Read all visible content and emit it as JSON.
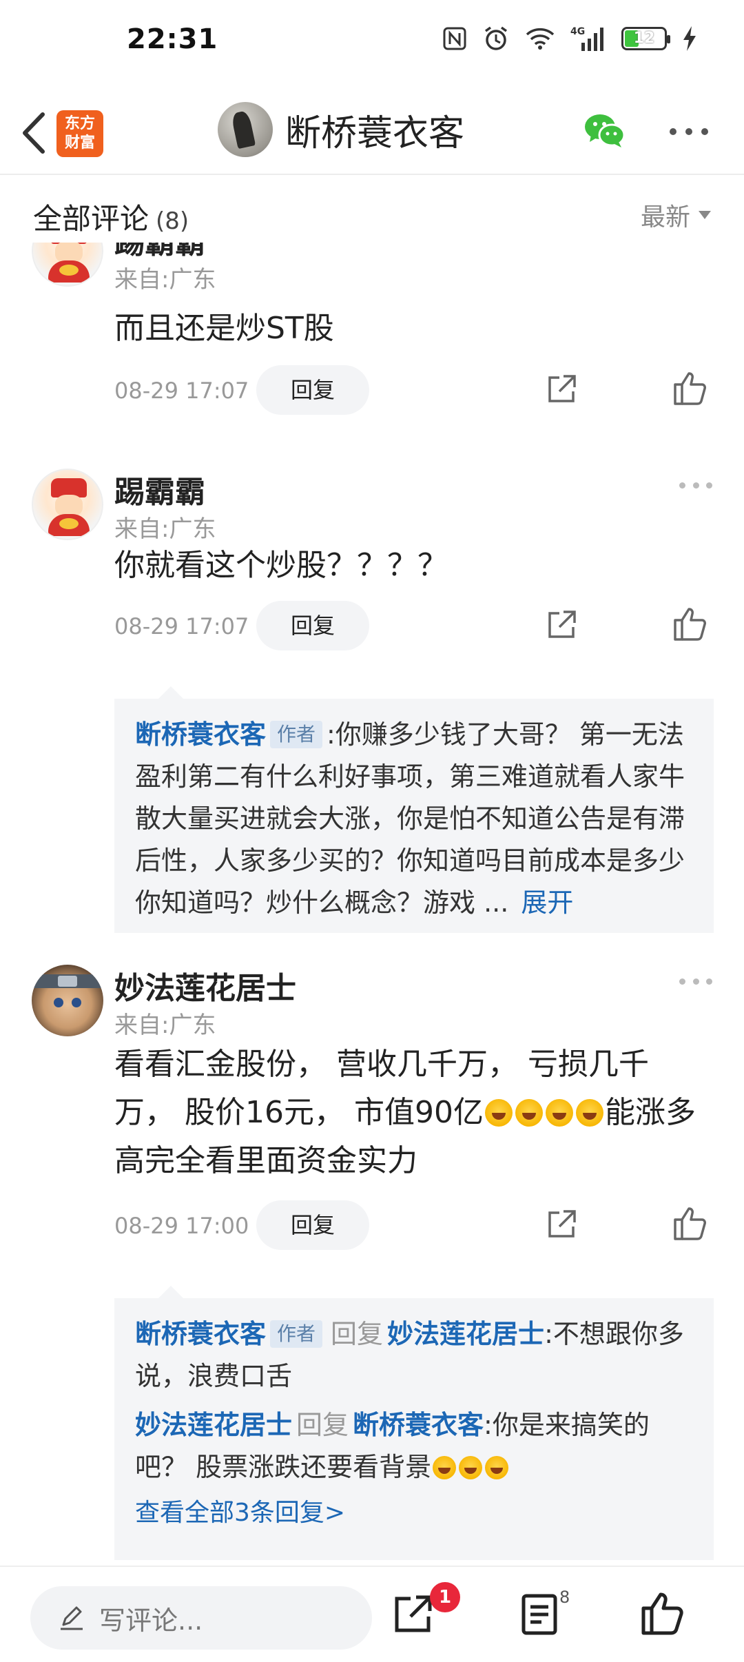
{
  "status_bar": {
    "time": "22:31",
    "battery_level": "12",
    "network": "4G"
  },
  "header": {
    "app_logo": "东方\n财富",
    "app_logo_line1": "东方",
    "app_logo_line2": "财富",
    "title": "断桥蓑衣客"
  },
  "comments_header": {
    "title": "全部评论",
    "count": "(8)",
    "sort": "最新"
  },
  "comments": [
    {
      "name": "踢霸霸",
      "location": "来自:广东",
      "text": "而且还是炒ST股",
      "time": "08-29 17:07",
      "reply_label": "回复"
    },
    {
      "name": "踢霸霸",
      "location": "来自:广东",
      "text": "你就看这个炒股？？？？",
      "time": "08-29 17:07",
      "reply_label": "回复",
      "replies": [
        {
          "author": "断桥蓑衣客",
          "tag": "作者",
          "text": ":你赚多少钱了大哥？ 第一无法盈利第二有什么利好事项，第三难道就看人家牛散大量买进就会大涨，你是怕不知道公告是有滞后性，人家多少买的？你知道吗目前成本是多少你知道吗？炒什么概念？游戏 ...",
          "expand": "展开"
        }
      ]
    },
    {
      "name": "妙法莲花居士",
      "location": "来自:广东",
      "text_part1": "看看汇金股份， 营收几千万， 亏损几千万， 股价16元， 市值90亿",
      "text_part2": "能涨多高完全看里面资金实力",
      "time": "08-29 17:00",
      "reply_label": "回复",
      "replies": [
        {
          "author": "断桥蓑衣客",
          "tag": "作者",
          "reply_word": "回复",
          "target": "妙法莲花居士",
          "text": ":不想跟你多说，浪费口舌"
        },
        {
          "author": "妙法莲花居士",
          "reply_word": "回复",
          "target": "断桥蓑衣客",
          "text": ":你是来搞笑的吧？ 股票涨跌还要看背景"
        }
      ],
      "view_all": "查看全部3条回复>"
    }
  ],
  "bottom_bar": {
    "placeholder": "写评论...",
    "share_badge": "1",
    "comment_count": "8"
  },
  "icons": {
    "back": "chevron-left-icon",
    "wechat": "wechat-icon",
    "more": "more-icon",
    "share": "share-icon",
    "like": "thumbs-up-icon",
    "edit": "pencil-icon",
    "list": "list-icon"
  },
  "colors": {
    "accent": "#1c67b5",
    "logo": "#f0601e",
    "badge": "#e8273a",
    "wechat": "#3ebf3e"
  }
}
